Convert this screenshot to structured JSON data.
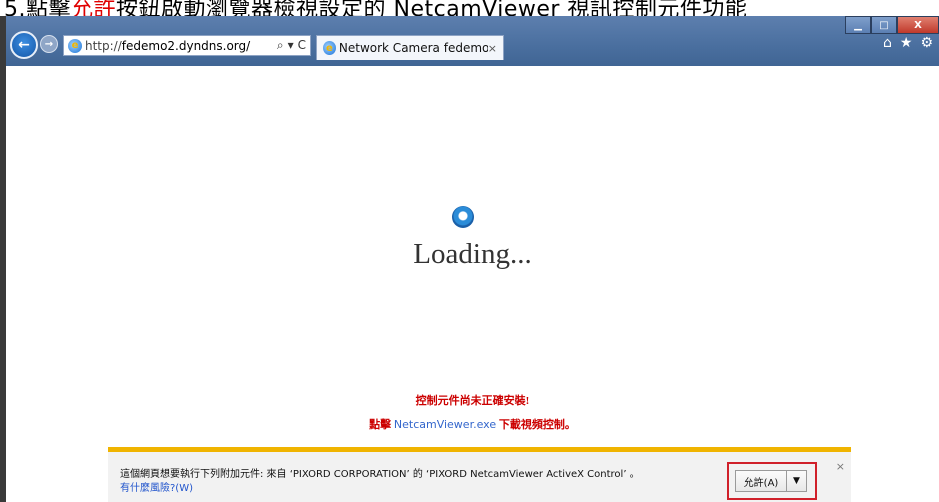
{
  "caption": {
    "prefix": "5.點擊",
    "highlight": "允許",
    "suffix": "按鈕啟動瀏覽器檢視設定的 NetcamViewer 視訊控制元件功能"
  },
  "window": {
    "min_label": "▁",
    "max_label": "□",
    "close_label": "X"
  },
  "nav": {
    "back_glyph": "←",
    "forward_glyph": "→"
  },
  "address_bar": {
    "url_prefix": "http://",
    "url_host": "fedemo2.dyndns.org/",
    "search_glyph": "⌕",
    "dropdown_glyph": "▾",
    "refresh_glyph": "C"
  },
  "tab": {
    "title": "Network Camera fedemo...",
    "close_glyph": "×"
  },
  "toolbar_icons": {
    "home": "⌂",
    "favorites": "★",
    "tools": "⚙"
  },
  "page": {
    "loading_text": "Loading...",
    "warning_line1": "控制元件尚未正確安裝!",
    "warning_line2_prefix": "點擊 ",
    "warning_line2_link": "NetcamViewer.exe",
    "warning_line2_suffix": " 下載視頻控制。"
  },
  "notification": {
    "message": "這個網頁想要執行下列附加元件: 來自 ‘PIXORD CORPORATION’ 的 ‘PIXORD NetcamViewer ActiveX Control’ 。",
    "risk_link": "有什麼風險?(W)",
    "allow_label": "允許(A)",
    "dropdown_glyph": "▼",
    "close_glyph": "×"
  },
  "colors": {
    "highlight_red": "#e00000",
    "notify_bar_top": "#f0b400",
    "allow_outline": "#d0202a",
    "link_blue": "#3366cc"
  }
}
